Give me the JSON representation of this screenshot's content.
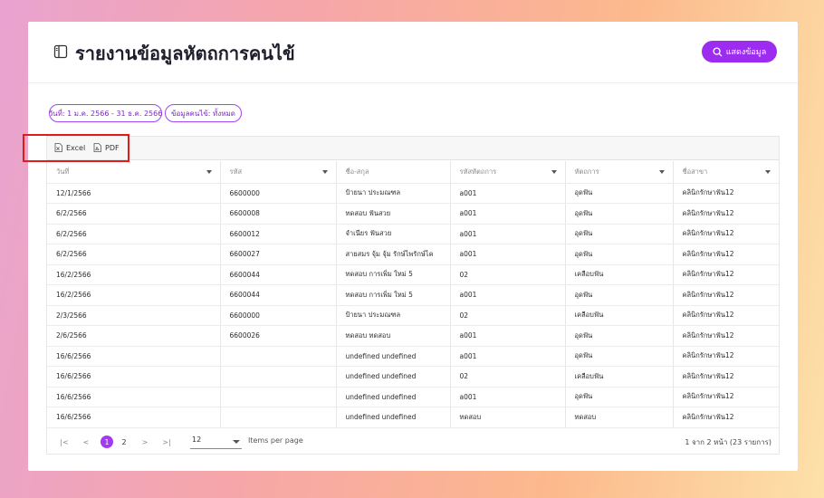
{
  "header": {
    "title": "รายงานข้อมูลหัตถการคนไข้",
    "show_button": "แสดงข้อมูล",
    "title_icon": "sidebar-panel-icon",
    "show_icon": "search-icon"
  },
  "filters": {
    "date": "วันที่: 1 ม.ค. 2566 - 31 ธ.ค. 2566",
    "patient": "ข้อมูลคนไข้: ทั้งหมด"
  },
  "toolbar": {
    "excel": "Excel",
    "pdf": "PDF"
  },
  "table": {
    "columns": [
      "วันที่",
      "รหัส",
      "ชื่อ-สกุล",
      "รหัสหัตถการ",
      "หัตถการ",
      "ชื่อสาขา"
    ],
    "rows": [
      [
        "12/1/2566",
        "6600000",
        "ป้ายนา ประมณฑล",
        "a001",
        "อุดฟัน",
        "คลินิกรักษาฟัน12"
      ],
      [
        "6/2/2566",
        "6600008",
        "ทดสอบ ฟันสวย",
        "a001",
        "อุดฟัน",
        "คลินิกรักษาฟัน12"
      ],
      [
        "6/2/2566",
        "6600012",
        "จำเนียร ฟันสวย",
        "a001",
        "อุดฟัน",
        "คลินิกรักษาฟัน12"
      ],
      [
        "6/2/2566",
        "6600027",
        "สายสมร จุ้ม จุ้ม รักษ์ไพรักษ์ไค",
        "a001",
        "อุดฟัน",
        "คลินิกรักษาฟัน12"
      ],
      [
        "16/2/2566",
        "6600044",
        "ทดสอบ การเพิ่ม ใหม่ 5",
        "02",
        "เคลือบฟัน",
        "คลินิกรักษาฟัน12"
      ],
      [
        "16/2/2566",
        "6600044",
        "ทดสอบ การเพิ่ม ใหม่ 5",
        "a001",
        "อุดฟัน",
        "คลินิกรักษาฟัน12"
      ],
      [
        "2/3/2566",
        "6600000",
        "ป้ายนา ประมณฑล",
        "02",
        "เคลือบฟัน",
        "คลินิกรักษาฟัน12"
      ],
      [
        "2/6/2566",
        "6600026",
        "ทดสอบ ทดสอบ",
        "a001",
        "อุดฟัน",
        "คลินิกรักษาฟัน12"
      ],
      [
        "16/6/2566",
        "",
        "undefined undefined",
        "a001",
        "อุดฟัน",
        "คลินิกรักษาฟัน12"
      ],
      [
        "16/6/2566",
        "",
        "undefined undefined",
        "02",
        "เคลือบฟัน",
        "คลินิกรักษาฟัน12"
      ],
      [
        "16/6/2566",
        "",
        "undefined undefined",
        "a001",
        "อุดฟัน",
        "คลินิกรักษาฟัน12"
      ],
      [
        "16/6/2566",
        "",
        "undefined undefined",
        "ทดสอบ",
        "ทดสอบ",
        "คลินิกรักษาฟัน12"
      ]
    ]
  },
  "pagination": {
    "pages": [
      "1",
      "2"
    ],
    "current_page": "1",
    "first": "|<",
    "prev": "<",
    "next": ">",
    "last": ">|",
    "page_size": "12",
    "items_per_page_label": "Items per page",
    "range_label": "1 จาก 2 หน้า (23 รายการ)"
  },
  "colors": {
    "accent": "#9b2cf0",
    "chip_border": "#a545ef",
    "highlight_frame": "#e01b1b"
  }
}
